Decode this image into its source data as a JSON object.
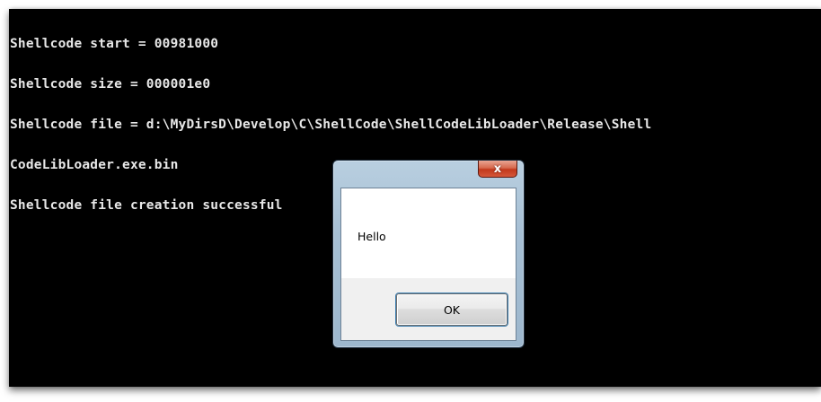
{
  "console": {
    "lines": [
      "Shellcode start = 00981000",
      "Shellcode size = 000001e0",
      "Shellcode file = d:\\MyDirsD\\Develop\\C\\ShellCode\\ShellCodeLibLoader\\Release\\Shell",
      "CodeLibLoader.exe.bin",
      "Shellcode file creation successful"
    ]
  },
  "dialog": {
    "message": "Hello",
    "ok_label": "OK",
    "close_icon": "close-icon",
    "close_glyph": "x"
  },
  "colors": {
    "console_background": "#000000",
    "console_text": "#e8e8e8",
    "close_button": "#c2391c",
    "dialog_frame": "#a6bfd4"
  }
}
